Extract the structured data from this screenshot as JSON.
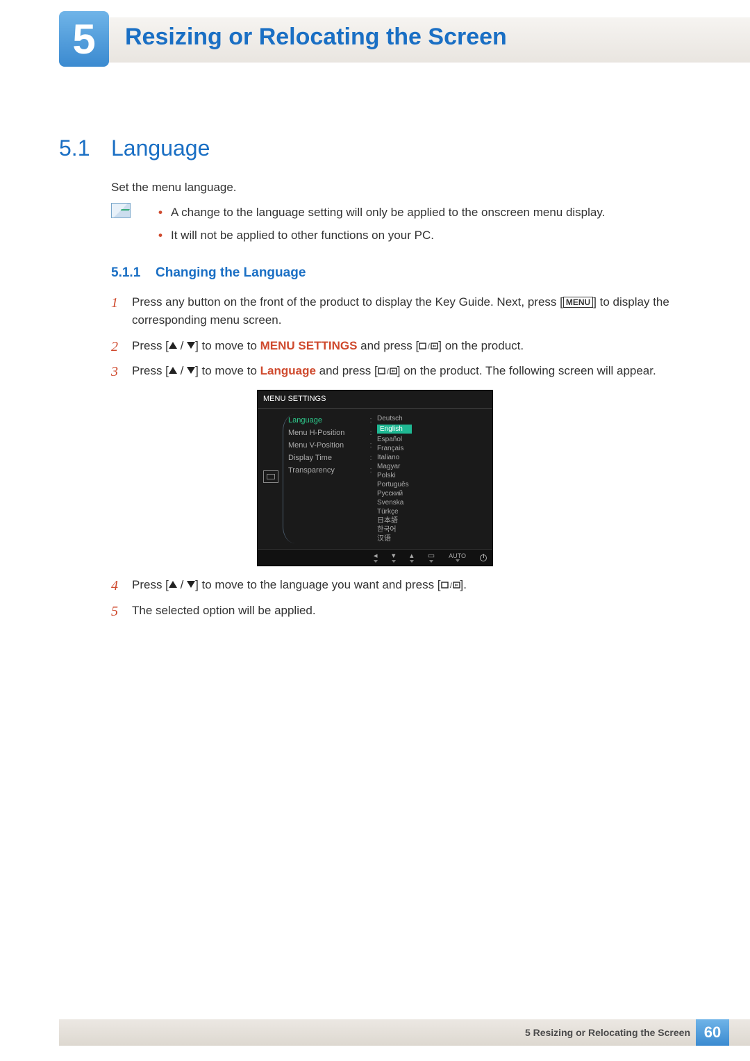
{
  "chapter": {
    "number": "5",
    "title": "Resizing or Relocating the Screen"
  },
  "section": {
    "number": "5.1",
    "title": "Language",
    "intro": "Set the menu language."
  },
  "notes": [
    "A change to the language setting will only be applied to the onscreen menu display.",
    "It will not be applied to other functions on your PC."
  ],
  "subsection": {
    "number": "5.1.1",
    "title": "Changing the Language"
  },
  "steps": {
    "s1_a": "Press any button on the front of the product to display the Key Guide. Next, press [",
    "s1_menu": "MENU",
    "s1_b": "] to display the corresponding menu screen.",
    "s2_a": "Press [",
    "s2_b": "] to move to ",
    "s2_kw": "MENU SETTINGS",
    "s2_c": " and press [",
    "s2_d": "] on the product.",
    "s3_a": "Press [",
    "s3_b": "] to move to ",
    "s3_kw": "Language",
    "s3_c": " and press [",
    "s3_d": "] on the product. The following screen will appear.",
    "s4_a": "Press [",
    "s4_b": "] to move to the language you want and press [",
    "s4_c": "].",
    "s5": "The selected option will be applied."
  },
  "osd": {
    "title": "MENU SETTINGS",
    "left": [
      "Language",
      "Menu H-Position",
      "Menu V-Position",
      "Display Time",
      "Transparency"
    ],
    "languages": [
      "Deutsch",
      "English",
      "Español",
      "Français",
      "Italiano",
      "Magyar",
      "Polski",
      "Português",
      "Русский",
      "Svenska",
      "Türkçe",
      "日本語",
      "한국어",
      "汉语"
    ],
    "selected_left": 0,
    "selected_lang": 1,
    "footer": {
      "auto": "AUTO"
    }
  },
  "footer": {
    "chapter_ref": "5 Resizing or Relocating the Screen",
    "page": "60"
  }
}
